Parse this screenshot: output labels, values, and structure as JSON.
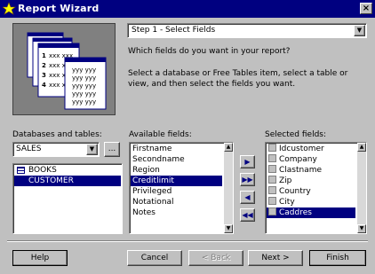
{
  "window": {
    "title": "Report Wizard",
    "close_glyph": "×",
    "icon": "wizard-wand-icon"
  },
  "step_select": {
    "value": "Step 1 - Select Fields",
    "arrow": "▼"
  },
  "instructions": {
    "question": "Which fields do you want in your report?",
    "detail": "Select a database or Free Tables item, select a table or view, and then select the fields you want."
  },
  "illustration": {
    "page_rows": [
      {
        "num": "1",
        "text": "xxx xxx"
      },
      {
        "num": "2",
        "text": "xxx xxx"
      },
      {
        "num": "3",
        "text": "xxx xxx"
      },
      {
        "num": "4",
        "text": "xxx xxx"
      }
    ],
    "detail_rows": [
      "yyy yyy",
      "yyy yyy",
      "yyy yyy",
      "yyy yyy",
      "yyy yyy"
    ]
  },
  "databases": {
    "label": "Databases and tables:",
    "selected": "SALES",
    "arrow": "▼",
    "browse_label": "...",
    "tables": [
      {
        "name": "BOOKS",
        "selected": false,
        "has_icon": true
      },
      {
        "name": "CUSTOMER",
        "selected": true,
        "has_icon": false
      }
    ]
  },
  "available_fields": {
    "label": "Available fields:",
    "items": [
      {
        "name": "Firstname",
        "selected": false
      },
      {
        "name": "Secondname",
        "selected": false
      },
      {
        "name": "Region",
        "selected": false
      },
      {
        "name": "Creditlimit",
        "selected": true
      },
      {
        "name": "Privileged",
        "selected": false
      },
      {
        "name": "Notational",
        "selected": false
      },
      {
        "name": "Notes",
        "selected": false
      }
    ]
  },
  "move_buttons": {
    "add": "▶",
    "add_all": "▶▶",
    "remove": "◀",
    "remove_all": "◀◀"
  },
  "selected_fields": {
    "label": "Selected fields:",
    "items": [
      {
        "name": "Idcustomer",
        "selected": false
      },
      {
        "name": "Company",
        "selected": false
      },
      {
        "name": "Clastname",
        "selected": false
      },
      {
        "name": "Zip",
        "selected": false
      },
      {
        "name": "Country",
        "selected": false
      },
      {
        "name": "City",
        "selected": false
      },
      {
        "name": "Caddres",
        "selected": true
      }
    ]
  },
  "buttons": {
    "help": "Help",
    "cancel": "Cancel",
    "back": "< Back",
    "next": "Next >",
    "finish": "Finish"
  },
  "scroll": {
    "up": "▲",
    "down": "▼"
  },
  "colors": {
    "title_bar": "#000080",
    "selection": "#000080",
    "face": "#c0c0c0"
  }
}
